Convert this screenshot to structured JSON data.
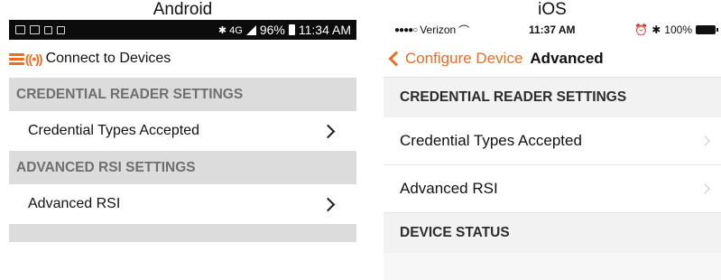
{
  "captions": {
    "android": "Android",
    "ios": "iOS"
  },
  "android": {
    "status_bar": {
      "signal_text": "✱ 4G",
      "battery": "96%",
      "time": "11:34 AM"
    },
    "app_bar": {
      "brand_glyph": "((•))",
      "title": "Connect to Devices"
    },
    "sections": [
      {
        "header": "CREDENTIAL READER SETTINGS",
        "item": "Credential Types Accepted"
      },
      {
        "header": "ADVANCED RSI SETTINGS",
        "item": "Advanced RSI"
      }
    ]
  },
  "ios": {
    "status_bar": {
      "dots": "●●●●○",
      "carrier": "Verizon",
      "wifi": "⌒",
      "time": "11:37 AM",
      "alarm": "⏰",
      "bluetooth": "✱",
      "battery": "100%"
    },
    "nav": {
      "back_label": "Configure Device",
      "title": "Advanced"
    },
    "sections": [
      {
        "header": "CREDENTIAL READER SETTINGS",
        "items": [
          "Credential Types Accepted",
          "Advanced RSI"
        ]
      },
      {
        "header": "DEVICE STATUS"
      }
    ]
  },
  "colors": {
    "accent": "#f26b21",
    "android_header_bg": "#dcdcdc",
    "ios_header_bg": "#f2f2f2"
  }
}
